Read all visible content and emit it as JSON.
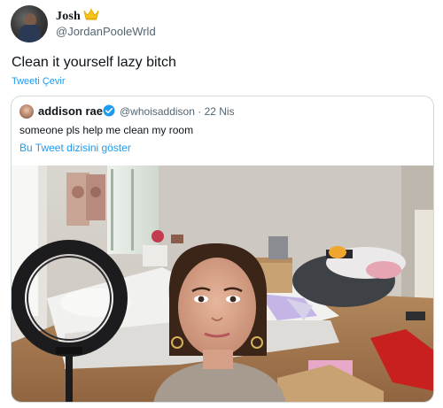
{
  "author": {
    "name": "Josh",
    "handle": "@JordanPooleWrld",
    "badge_icon": "crown-icon"
  },
  "tweet": {
    "text": "Clean it yourself lazy bitch",
    "translate_label": "Tweeti Çevir"
  },
  "quoted": {
    "name": "addison rae",
    "verified_icon": "verified-badge-icon",
    "handle": "@whoisaddison",
    "date": "· 22 Nis",
    "text": "someone pls help me clean my room",
    "thread_label": "Bu Tweet dizisini göster"
  },
  "colors": {
    "link": "#1d9bf0",
    "secondary_text": "#536471",
    "border": "#cfd9de",
    "verified": "#1d9bf0",
    "crown": "#f5c518"
  }
}
